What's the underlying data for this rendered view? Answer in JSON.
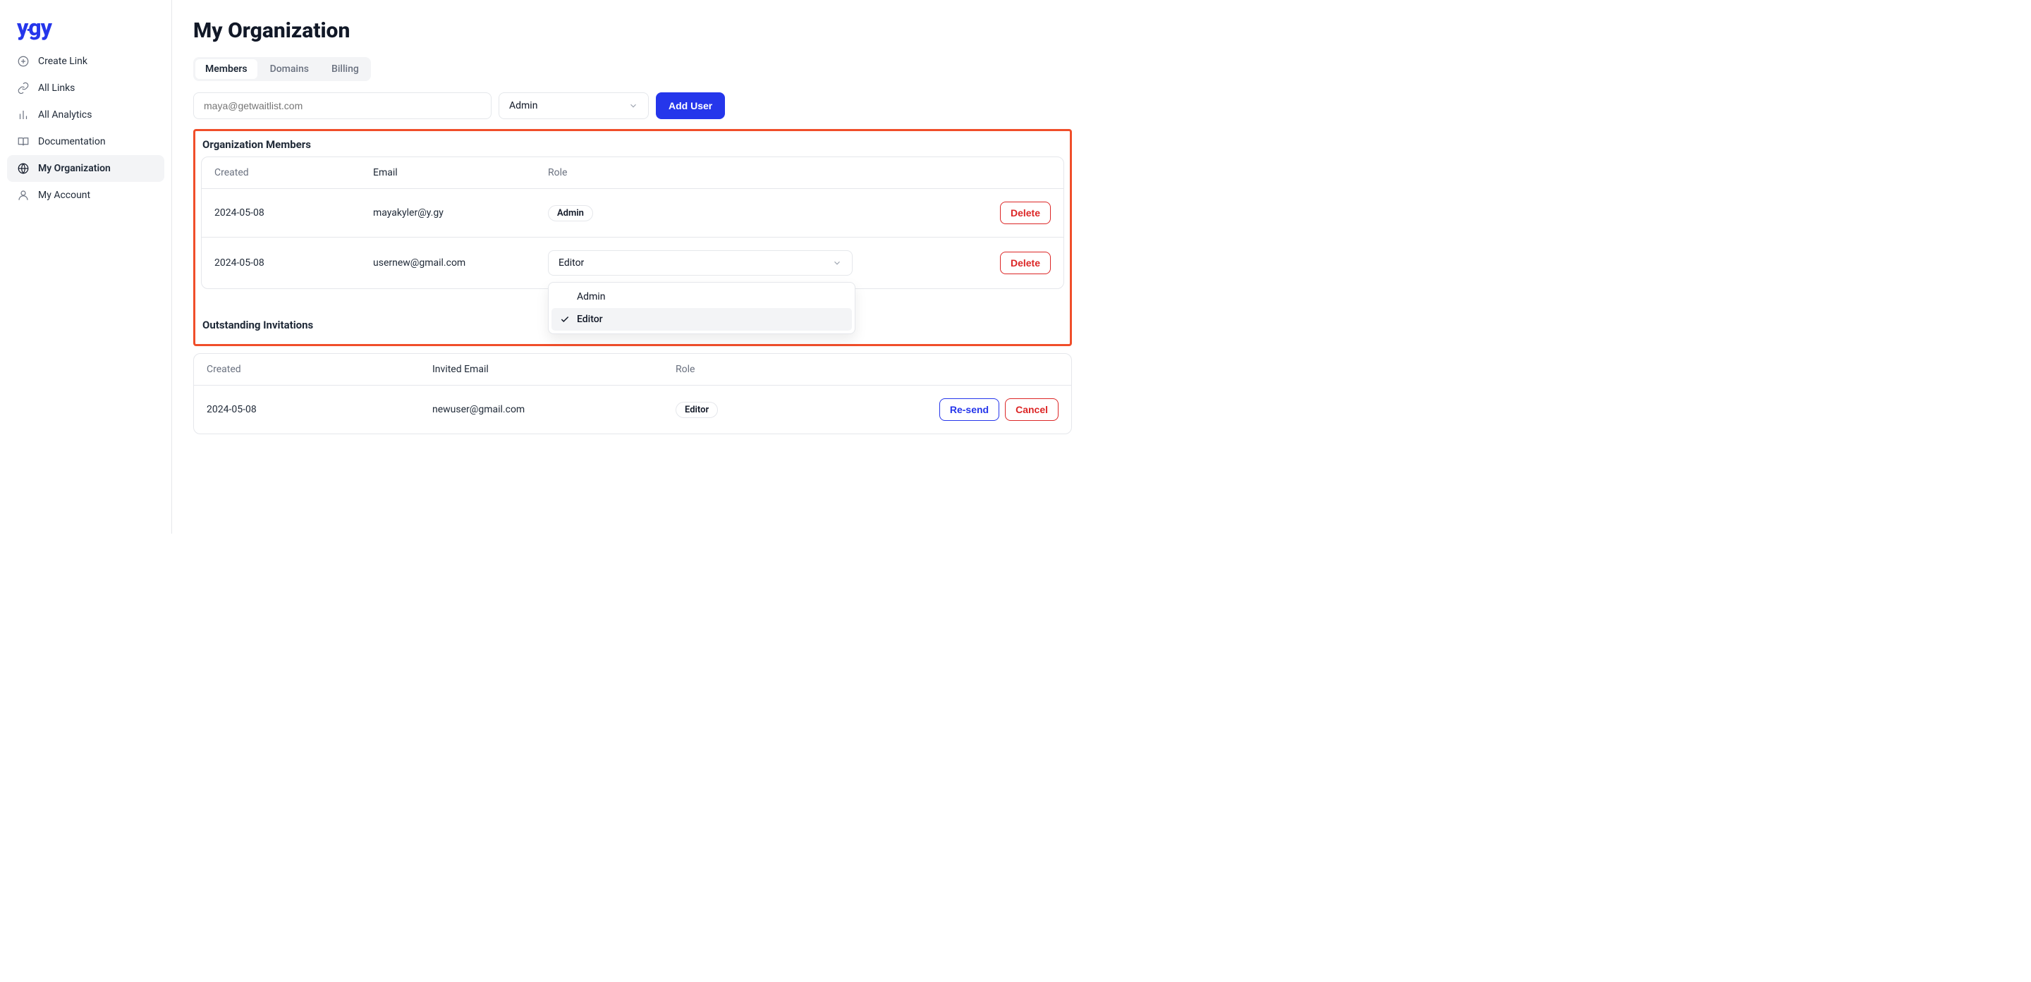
{
  "logo": {
    "p1": "y",
    "p2": "gy"
  },
  "nav": {
    "createLink": "Create Link",
    "allLinks": "All Links",
    "allAnalytics": "All Analytics",
    "documentation": "Documentation",
    "myOrganization": "My Organization",
    "myAccount": "My Account"
  },
  "page": {
    "title": "My Organization"
  },
  "tabs": {
    "members": "Members",
    "domains": "Domains",
    "billing": "Billing"
  },
  "addUser": {
    "placeholder": "maya@getwaitlist.com",
    "roleSelected": "Admin",
    "button": "Add User"
  },
  "membersSection": {
    "title": "Organization Members",
    "cols": {
      "created": "Created",
      "email": "Email",
      "role": "Role"
    },
    "rows": [
      {
        "created": "2024-05-08",
        "email": "mayakyler@y.gy",
        "role": "Admin",
        "roleType": "badge"
      },
      {
        "created": "2024-05-08",
        "email": "usernew@gmail.com",
        "role": "Editor",
        "roleType": "select"
      }
    ],
    "deleteLabel": "Delete",
    "dropdown": {
      "options": [
        "Admin",
        "Editor"
      ],
      "selected": "Editor"
    }
  },
  "invitationsSection": {
    "title": "Outstanding Invitations",
    "cols": {
      "created": "Created",
      "email": "Invited Email",
      "role": "Role"
    },
    "rows": [
      {
        "created": "2024-05-08",
        "email": "newuser@gmail.com",
        "role": "Editor"
      }
    ],
    "resendLabel": "Re-send",
    "cancelLabel": "Cancel"
  }
}
